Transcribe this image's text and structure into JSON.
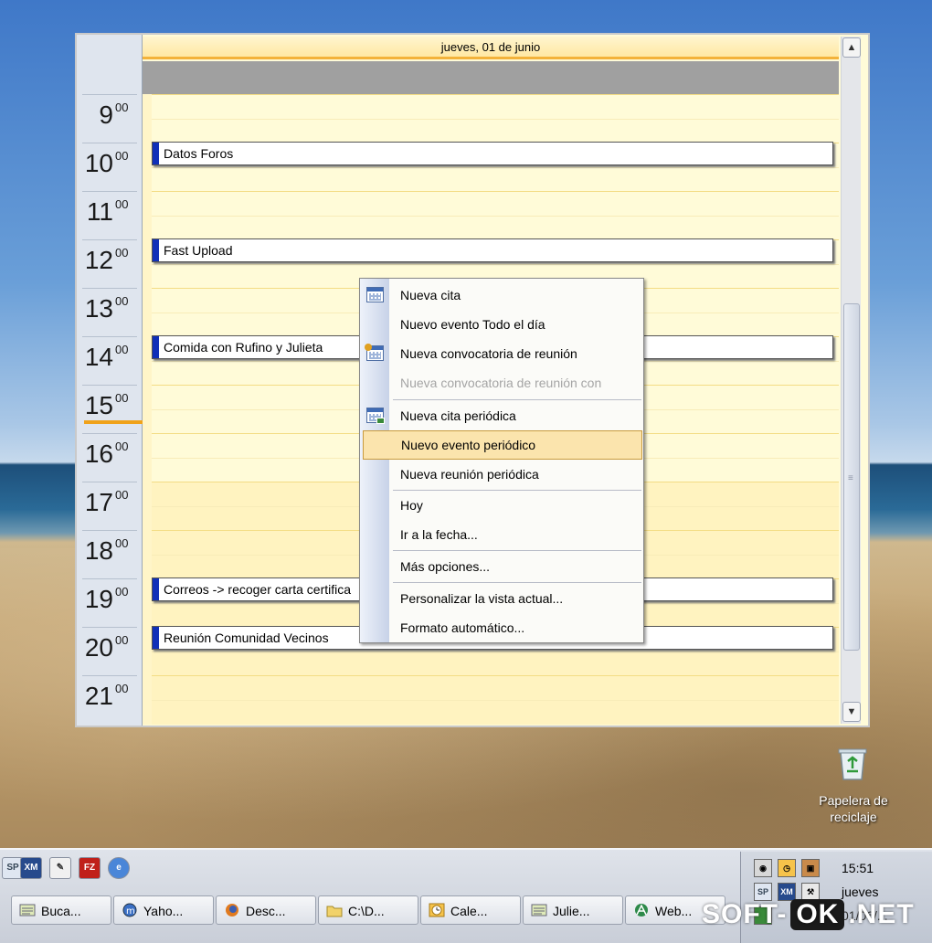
{
  "calendar": {
    "day_header": "jueves, 01 de junio",
    "hours": [
      {
        "h": "9",
        "m": "00"
      },
      {
        "h": "10",
        "m": "00"
      },
      {
        "h": "11",
        "m": "00"
      },
      {
        "h": "12",
        "m": "00"
      },
      {
        "h": "13",
        "m": "00"
      },
      {
        "h": "14",
        "m": "00"
      },
      {
        "h": "15",
        "m": "00"
      },
      {
        "h": "16",
        "m": "00"
      },
      {
        "h": "17",
        "m": "00"
      },
      {
        "h": "18",
        "m": "00"
      },
      {
        "h": "19",
        "m": "00"
      },
      {
        "h": "20",
        "m": "00"
      },
      {
        "h": "21",
        "m": "00"
      }
    ],
    "appointments": [
      {
        "title": "Datos Foros",
        "hour": "10"
      },
      {
        "title": "Fast Upload",
        "hour": "12"
      },
      {
        "title": "Comida con Rufino y Julieta",
        "hour": "14"
      },
      {
        "title": "Correos -> recoger carta certifica",
        "hour": "19"
      },
      {
        "title": "Reunión Comunidad Vecinos",
        "hour": "20"
      }
    ],
    "scroll_up_icon": "triangle-up",
    "scroll_down_icon": "triangle-down",
    "colors": {
      "accent": "#1030b8",
      "header_border": "#f3b23a",
      "now_marker": "#f0a21a"
    }
  },
  "context_menu": {
    "items": [
      {
        "label": "Nueva cita",
        "icon": "calendar-icon"
      },
      {
        "label": "Nuevo evento Todo el día"
      },
      {
        "label": "Nueva convocatoria de reunión",
        "icon": "meeting-icon"
      },
      {
        "label": "Nueva convocatoria de reunión con",
        "disabled": true
      },
      {
        "label": "Nueva cita periódica",
        "icon": "recurring-icon"
      },
      {
        "label": "Nuevo evento periódico",
        "selected": true
      },
      {
        "label": "Nueva reunión periódica"
      },
      {
        "label": "Hoy"
      },
      {
        "label": "Ir a la fecha..."
      },
      {
        "label": "Más opciones..."
      },
      {
        "label": "Personalizar la vista actual..."
      },
      {
        "label": "Formato automático..."
      }
    ],
    "selected_color": "#fbe4ad"
  },
  "desktop": {
    "recycle_bin_label": "Papelera de reciclaje"
  },
  "taskbar": {
    "quick_launch": [
      "SP",
      "XM",
      "",
      "FZ",
      ""
    ],
    "buttons": [
      {
        "label": "Buca...",
        "icon": "notepad-icon"
      },
      {
        "label": "Yaho...",
        "icon": "messenger-icon"
      },
      {
        "label": "Desc...",
        "icon": "firefox-icon"
      },
      {
        "label": "C:\\D...",
        "icon": "folder-icon"
      },
      {
        "label": "Cale...",
        "icon": "clock-icon"
      },
      {
        "label": "Julie...",
        "icon": "notepad-icon"
      },
      {
        "label": "Web...",
        "icon": "web-icon"
      }
    ],
    "tray": {
      "time": "15:51",
      "day": "jueves",
      "date": "01/06/..."
    }
  },
  "watermark": {
    "left": "SOFT-",
    "mid": "OK",
    "right": ".NET"
  }
}
